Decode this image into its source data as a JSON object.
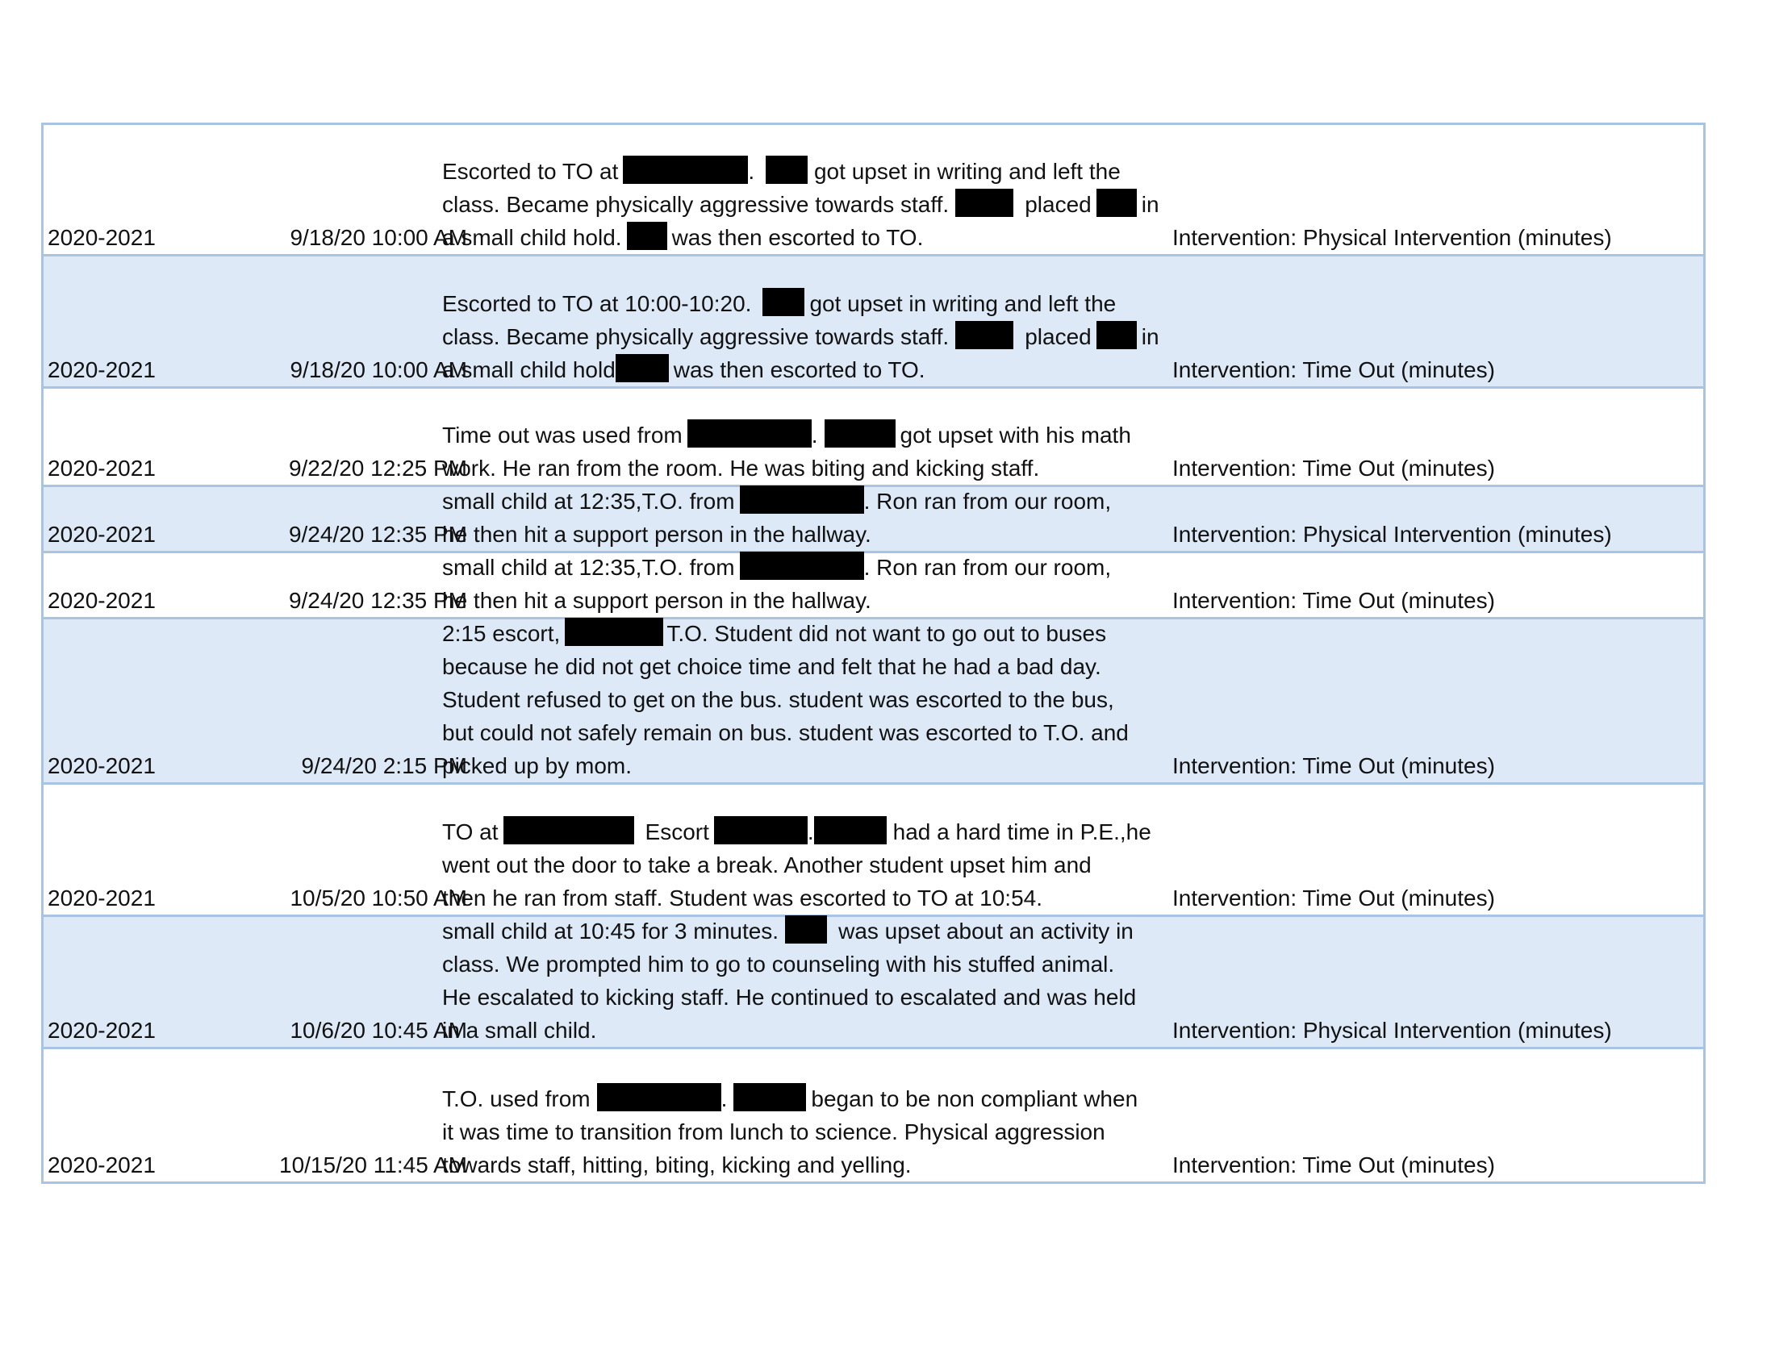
{
  "rows": [
    {
      "year": "2020-2021",
      "date": "9/18/20 10:00 AM",
      "desc": [
        "Escorted to TO at",
        ".",
        "got upset in writing and left the",
        "class. Became physically aggressive towards staff.",
        "placed",
        "in",
        "a small child hold.",
        "was then escorted to TO."
      ],
      "type": "Intervention: Physical Intervention (minutes)"
    },
    {
      "year": "2020-2021",
      "date": "9/18/20 10:00 AM",
      "desc": [
        "Escorted to TO at 10:00-10:20.",
        "got upset in writing and left the",
        "class. Became physically aggressive towards staff.",
        "placed",
        "in",
        "a small child hold",
        "was then escorted to TO."
      ],
      "type": "Intervention: Time Out (minutes)"
    },
    {
      "year": "2020-2021",
      "date": "9/22/20 12:25 PM",
      "desc": [
        "Time out was used from",
        ".",
        "got upset with his math",
        "work. He ran from the room. He was biting and kicking staff."
      ],
      "type": "Intervention: Time Out (minutes)"
    },
    {
      "year": "2020-2021",
      "date": "9/24/20 12:35 PM",
      "desc": [
        "small child at 12:35,T.O. from",
        ".  Ron ran from our room,",
        "he then hit a support person in the hallway."
      ],
      "type": "Intervention: Physical Intervention (minutes)"
    },
    {
      "year": "2020-2021",
      "date": "9/24/20 12:35 PM",
      "desc": [
        "small child at 12:35,T.O. from",
        ".  Ron ran from our room,",
        "he then hit a support person in the hallway."
      ],
      "type": "Intervention: Time Out (minutes)"
    },
    {
      "year": "2020-2021",
      "date": "9/24/20 2:15 PM",
      "desc": [
        "2:15 escort,",
        "T.O. Student did not want to go out to buses",
        "because he did not get choice time and felt that he had a bad day.",
        "Student refused to get on the bus. student was escorted to the bus,",
        "but could not safely remain on bus. student was escorted to T.O. and",
        "picked up by mom."
      ],
      "type": "Intervention: Time Out (minutes)"
    },
    {
      "year": "2020-2021",
      "date": "10/5/20 10:50 AM",
      "desc": [
        "TO at",
        "Escort",
        ".",
        "had a hard time in P.E.,he",
        "went out the door to take a break. Another student upset him and",
        "then he ran from staff. Student was escorted to TO at 10:54."
      ],
      "type": "Intervention: Time Out (minutes)"
    },
    {
      "year": "2020-2021",
      "date": "10/6/20 10:45 AM",
      "desc": [
        "small child at 10:45 for 3 minutes.",
        "was upset about an activity in",
        "class. We prompted him to go to counseling with his stuffed animal.",
        "He escalated to kicking staff. He continued to escalated and was held",
        "in a small child."
      ],
      "type": "Intervention: Physical Intervention (minutes)"
    },
    {
      "year": "2020-2021",
      "date": "10/15/20 11:45 AM",
      "desc": [
        "T.O. used from",
        ".",
        "began to be non compliant when",
        "it was time to transition from lunch to science. Physical aggression",
        "towards staff, hitting, biting, kicking and yelling."
      ],
      "type": "Intervention: Time Out (minutes)"
    }
  ]
}
